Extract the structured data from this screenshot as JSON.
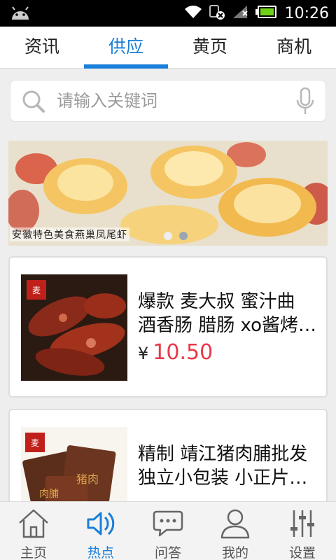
{
  "status_bar": {
    "time": "10:26"
  },
  "tabs": [
    {
      "label": "资讯",
      "active": false
    },
    {
      "label": "供应",
      "active": true
    },
    {
      "label": "黄页",
      "active": false
    },
    {
      "label": "商机",
      "active": false
    }
  ],
  "search": {
    "placeholder": "请输入关键词"
  },
  "banner": {
    "caption": "安徽特色美食燕巢凤尾虾"
  },
  "products": [
    {
      "title_line1": "爆款 麦大叔 蜜汁曲",
      "title_line2": "酒香肠 腊肠 xo酱烤…",
      "currency": "¥",
      "price": "10.50"
    },
    {
      "title_line1": "精制 靖江猪肉脯批发",
      "title_line2": "独立小包装 小正片…"
    }
  ],
  "bottom_nav": [
    {
      "label": "主页",
      "icon": "home-icon",
      "active": false
    },
    {
      "label": "热点",
      "icon": "hotspot-icon",
      "active": true
    },
    {
      "label": "问答",
      "icon": "chat-icon",
      "active": false
    },
    {
      "label": "我的",
      "icon": "person-icon",
      "active": false
    },
    {
      "label": "设置",
      "icon": "settings-sliders-icon",
      "active": false
    }
  ],
  "colors": {
    "accent": "#1a7fd8",
    "price": "#e8384a"
  }
}
